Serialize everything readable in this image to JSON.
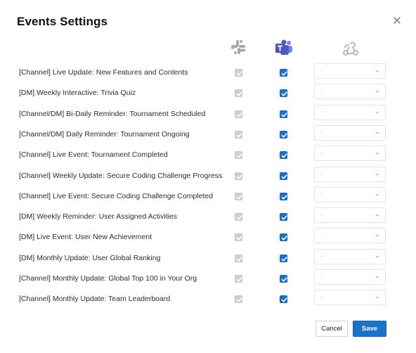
{
  "title": "Events Settings",
  "icons": {
    "close": "close-icon",
    "slack": "slack-icon",
    "teams": "microsoft-teams-icon",
    "webhook": "webhook-icon"
  },
  "colors": {
    "teams_checkbox": "#1a6fd4",
    "save_button": "#1a73c8",
    "slack_checkbox_disabled": "#cfcfcf"
  },
  "events": [
    {
      "label": "[Channel] Live Update: New Features and Contents",
      "slack": true,
      "teams": true,
      "webhook": "-"
    },
    {
      "label": "[DM] Weekly Interactive: Trivia Quiz",
      "slack": true,
      "teams": true,
      "webhook": "-"
    },
    {
      "label": "[Channel/DM] Bi-Daily Reminder: Tournament Scheduled",
      "slack": true,
      "teams": true,
      "webhook": "-"
    },
    {
      "label": "[Channel/DM] Daily Reminder: Tournament Ongoing",
      "slack": true,
      "teams": true,
      "webhook": "-"
    },
    {
      "label": "[Channel] Live Event: Tournament Completed",
      "slack": true,
      "teams": true,
      "webhook": "-"
    },
    {
      "label": "[Channel] Weekly Update: Secure Coding Challenge Progress",
      "slack": true,
      "teams": true,
      "webhook": "-"
    },
    {
      "label": "[Channel] Live Event: Secure Coding Challenge Completed",
      "slack": true,
      "teams": true,
      "webhook": "-"
    },
    {
      "label": "[DM] Weekly Reminder: User Assigned Activities",
      "slack": true,
      "teams": true,
      "webhook": "-"
    },
    {
      "label": "[DM] Live Event: User New Achievement",
      "slack": true,
      "teams": true,
      "webhook": "-"
    },
    {
      "label": "[DM] Monthly Update: User Global Ranking",
      "slack": true,
      "teams": true,
      "webhook": "-"
    },
    {
      "label": "[Channel] Monthly Update: Global Top 100 in Your Org",
      "slack": true,
      "teams": true,
      "webhook": "-"
    },
    {
      "label": "[Channel] Monthly Update: Team Leaderboard",
      "slack": true,
      "teams": true,
      "webhook": "-"
    }
  ],
  "buttons": {
    "cancel": "Cancel",
    "save": "Save"
  }
}
